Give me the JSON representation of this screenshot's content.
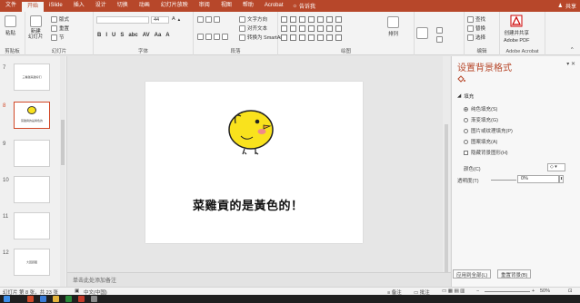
{
  "tabs": [
    "文件",
    "开始",
    "iSlide",
    "插入",
    "设计",
    "切换",
    "动画",
    "幻灯片放映",
    "审阅",
    "视图",
    "帮助",
    "Acrobat"
  ],
  "active_tab": "开始",
  "tell_me": "告诉我",
  "user_name": "共享",
  "ribbon": {
    "clipboard": {
      "paste": "粘贴",
      "label": "剪贴板"
    },
    "slides": {
      "new_slide": "新建\n幻灯片",
      "layout": "版式",
      "reset": "重置",
      "section": "节",
      "label": "幻灯片"
    },
    "font": {
      "size": "44",
      "label": "字体",
      "format_buttons": [
        "B",
        "I",
        "U",
        "S",
        "abc",
        "AV",
        "Aa",
        "A"
      ]
    },
    "paragraph": {
      "text_direction": "文字方向",
      "align_text": "对齐文本",
      "smartart": "转换为 SmartArt",
      "label": "段落"
    },
    "drawing": {
      "arrange": "排列",
      "quick_styles": "快速样式",
      "label": "绘图",
      "shape_fill": "形状填充",
      "shape_outline": "形状轮廓",
      "shape_effect": "形状效果"
    },
    "editing": {
      "find": "查找",
      "replace": "替换",
      "select": "选择",
      "label": "编辑"
    },
    "adobe": {
      "create_share": "创建并共享",
      "pdf": "Adobe PDF",
      "label": "Adobe Acrobat"
    }
  },
  "thumbnails": [
    {
      "num": "7",
      "text": "三看越来越好们"
    },
    {
      "num": "8",
      "text": "菜雞貢的是黃色的",
      "selected": true
    },
    {
      "num": "9",
      "text": ""
    },
    {
      "num": "10",
      "text": ""
    },
    {
      "num": "11",
      "text": ""
    },
    {
      "num": "12",
      "text": "大回顾图"
    }
  ],
  "slide": {
    "caption": "菜雞貢的是黃色的！"
  },
  "notes_placeholder": "单击此处添加备注",
  "format_pane": {
    "title": "设置背景格式",
    "section": "填充",
    "options": [
      {
        "label": "纯色填充(S)",
        "type": "radio",
        "checked": true
      },
      {
        "label": "渐变填充(G)",
        "type": "radio",
        "checked": false
      },
      {
        "label": "图片或纹理填充(P)",
        "type": "radio",
        "checked": false
      },
      {
        "label": "图案填充(A)",
        "type": "radio",
        "checked": false
      },
      {
        "label": "隐藏背景图形(H)",
        "type": "check",
        "checked": false
      }
    ],
    "color_label": "颜色(C)",
    "transparency_label": "透明度(T)",
    "transparency_value": "0%",
    "apply_all": "应用到全部(L)",
    "reset_bg": "重置背景(B)"
  },
  "status": {
    "slide_info": "幻灯片 第 8 张，共 23 张",
    "language": "中文(中国)",
    "notes": "备注",
    "comments": "批注",
    "zoom": "50%"
  },
  "colors": {
    "accent": "#b7472a",
    "chick_body": "#f9e21d",
    "chick_cheek": "#f08a8a"
  }
}
